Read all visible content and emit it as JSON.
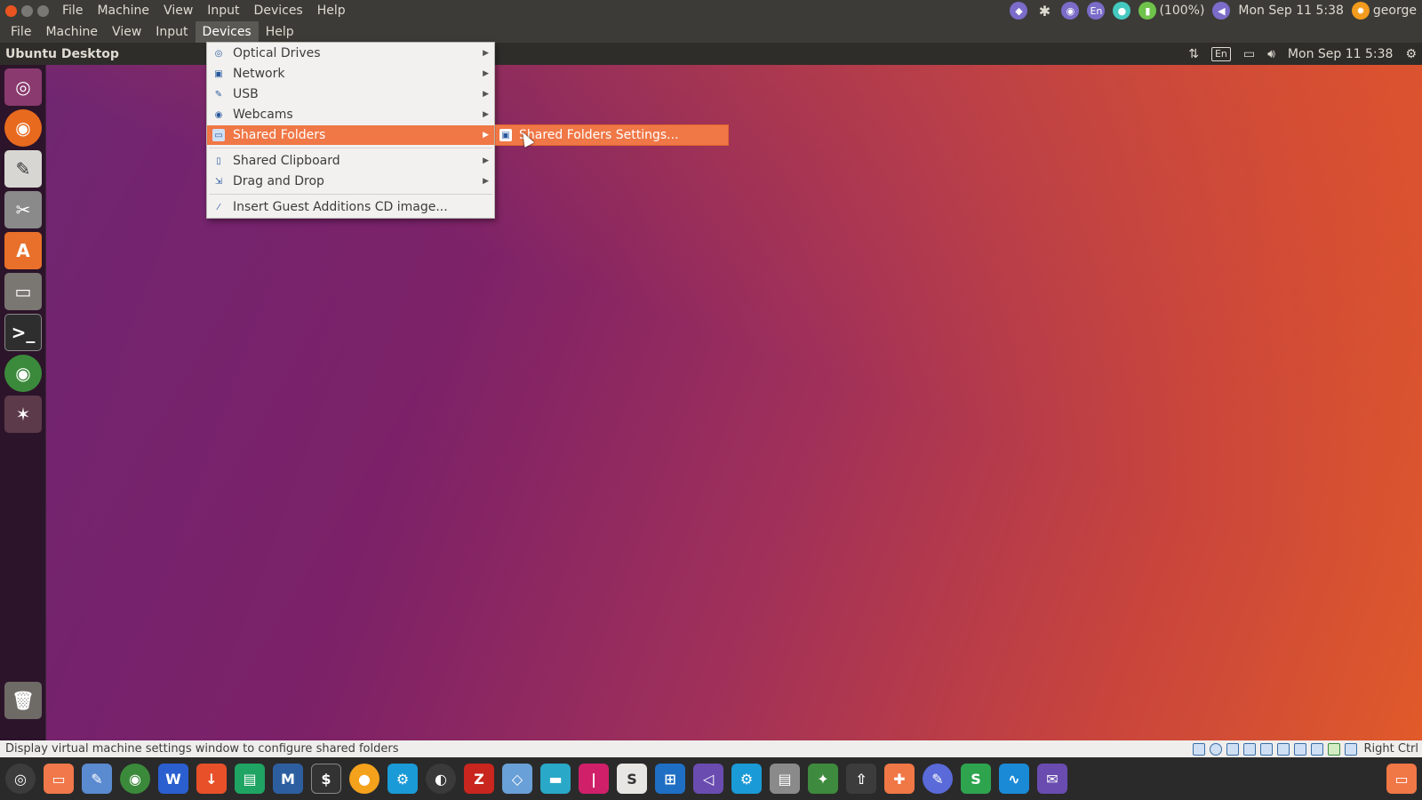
{
  "host_bar": {
    "menu": [
      "File",
      "Machine",
      "View",
      "Input",
      "Devices",
      "Help"
    ],
    "tray": {
      "keyboard_layout": "En",
      "battery": "(100%)",
      "clock": "Mon Sep 11  5:38",
      "user": "george"
    }
  },
  "vm_bar": {
    "menu": [
      "File",
      "Machine",
      "View",
      "Input",
      "Devices",
      "Help"
    ],
    "active_index": 4
  },
  "guest_panel": {
    "title": "Ubuntu Desktop",
    "keyboard_layout": "En",
    "clock": "Mon Sep 11  5:38"
  },
  "devices_menu": {
    "items": [
      {
        "label": "Optical Drives",
        "icon": "disc-icon",
        "submenu": true
      },
      {
        "label": "Network",
        "icon": "network-icon",
        "submenu": true
      },
      {
        "label": "USB",
        "icon": "usb-icon",
        "submenu": true
      },
      {
        "label": "Webcams",
        "icon": "webcam-icon",
        "submenu": true
      },
      {
        "label": "Shared Folders",
        "icon": "folder-icon",
        "submenu": true,
        "highlighted": true
      },
      {
        "label": "Shared Clipboard",
        "icon": "clipboard-icon",
        "submenu": true
      },
      {
        "label": "Drag and Drop",
        "icon": "drag-drop-icon",
        "submenu": true
      },
      {
        "label": "Insert Guest Additions CD image...",
        "icon": "cd-insert-icon",
        "submenu": false
      }
    ]
  },
  "submenu": {
    "label": "Shared Folders Settings..."
  },
  "status_bar": {
    "message": "Display virtual machine settings window to configure shared folders",
    "host_key": "Right Ctrl"
  },
  "colors": {
    "accent": "#f07746",
    "panel": "#3c3b37",
    "menu_bg": "#f2f1f0"
  },
  "launcher": {
    "icons": [
      "ubuntu-dash-icon",
      "firefox-icon",
      "text-editor-icon",
      "system-settings-icon",
      "software-center-icon",
      "files-icon",
      "terminal-icon",
      "chrome-icon",
      "unity-tweak-icon",
      "trash-icon"
    ]
  },
  "dock": {
    "icons": [
      "ubuntu-icon",
      "files-icon",
      "inkscape-icon",
      "chrome-icon",
      "writer-icon",
      "download-icon",
      "sheets-icon",
      "pen-icon",
      "terminal-icon",
      "lollypop-icon",
      "settings-icon",
      "steam-icon",
      "filezilla-icon",
      "box-icon",
      "folder-icon",
      "slides-icon",
      "sublime-icon",
      "windows-icon",
      "vscode-icon",
      "gear-icon",
      "document-viewer-icon",
      "android-icon",
      "upload-icon",
      "puzzle-icon",
      "color-picker-icon",
      "spreadsheet-icon",
      "monitor-icon",
      "mail-icon",
      "orange-app-icon"
    ]
  }
}
